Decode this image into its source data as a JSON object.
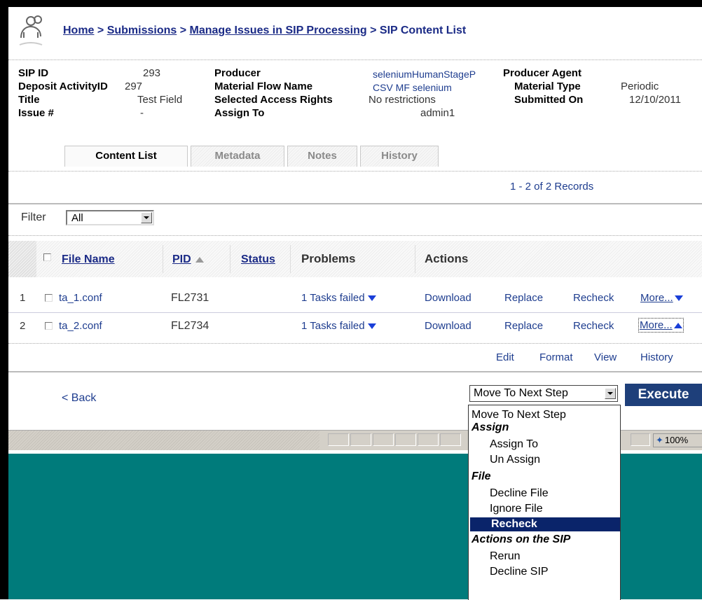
{
  "breadcrumb": {
    "home": "Home",
    "submissions": "Submissions",
    "manage": "Manage Issues in SIP Processing",
    "current": "SIP Content List",
    "sep": ">"
  },
  "details": {
    "sip_id_label": "SIP ID",
    "sip_id": "293",
    "deposit_label": "Deposit ActivityID",
    "deposit": "297",
    "title_label": "Title",
    "title": "Test Field",
    "issue_label": "Issue #",
    "issue": "-",
    "producer_label": "Producer",
    "producer": "seleniumHumanStageP",
    "producer_agent_label": "Producer Agent",
    "mf_label": "Material Flow Name",
    "mf": "CSV MF selenium",
    "material_type_label": "Material Type",
    "material_type": "Periodic",
    "access_label": "Selected Access Rights",
    "access": "No restrictions",
    "submitted_label": "Submitted On",
    "submitted": "12/10/2011",
    "assign_label": "Assign To",
    "assign": "admin1"
  },
  "tabs": [
    "Content List",
    "Metadata",
    "Notes",
    "History"
  ],
  "records": "1 - 2 of 2 Records",
  "filter": {
    "label": "Filter",
    "value": "All"
  },
  "table": {
    "headers": {
      "file_name": "File Name",
      "pid": "PID",
      "status": "Status",
      "problems": "Problems",
      "actions": "Actions"
    },
    "rows": [
      {
        "num": "1",
        "file": "ta_1.conf",
        "pid": "FL2731",
        "problems": "1 Tasks failed",
        "download": "Download",
        "replace": "Replace",
        "recheck": "Recheck",
        "more": "More..."
      },
      {
        "num": "2",
        "file": "ta_2.conf",
        "pid": "FL2734",
        "problems": "1 Tasks failed",
        "download": "Download",
        "replace": "Replace",
        "recheck": "Recheck",
        "more": "More..."
      }
    ],
    "submenu": [
      "Edit",
      "Format",
      "View",
      "History"
    ]
  },
  "back": "< Back",
  "action_select": {
    "value": "Move To Next Step"
  },
  "execute": "Execute",
  "dropdown": {
    "top": "Move To Next Step",
    "assign_group": "Assign",
    "assign_to": "Assign To",
    "un_assign": "Un Assign",
    "file_group": "File",
    "decline_file": "Decline File",
    "ignore_file": "Ignore File",
    "recheck": "Recheck",
    "sip_group": "Actions on the SIP",
    "rerun": "Rerun",
    "decline_sip": "Decline SIP"
  },
  "statusbar": {
    "zoom": "100%"
  },
  "colors": {
    "teal_bg": "#007b7b",
    "link": "#1a2a86",
    "menu_selected": "#0a246a",
    "execute_bg": "#1e3f7a"
  }
}
